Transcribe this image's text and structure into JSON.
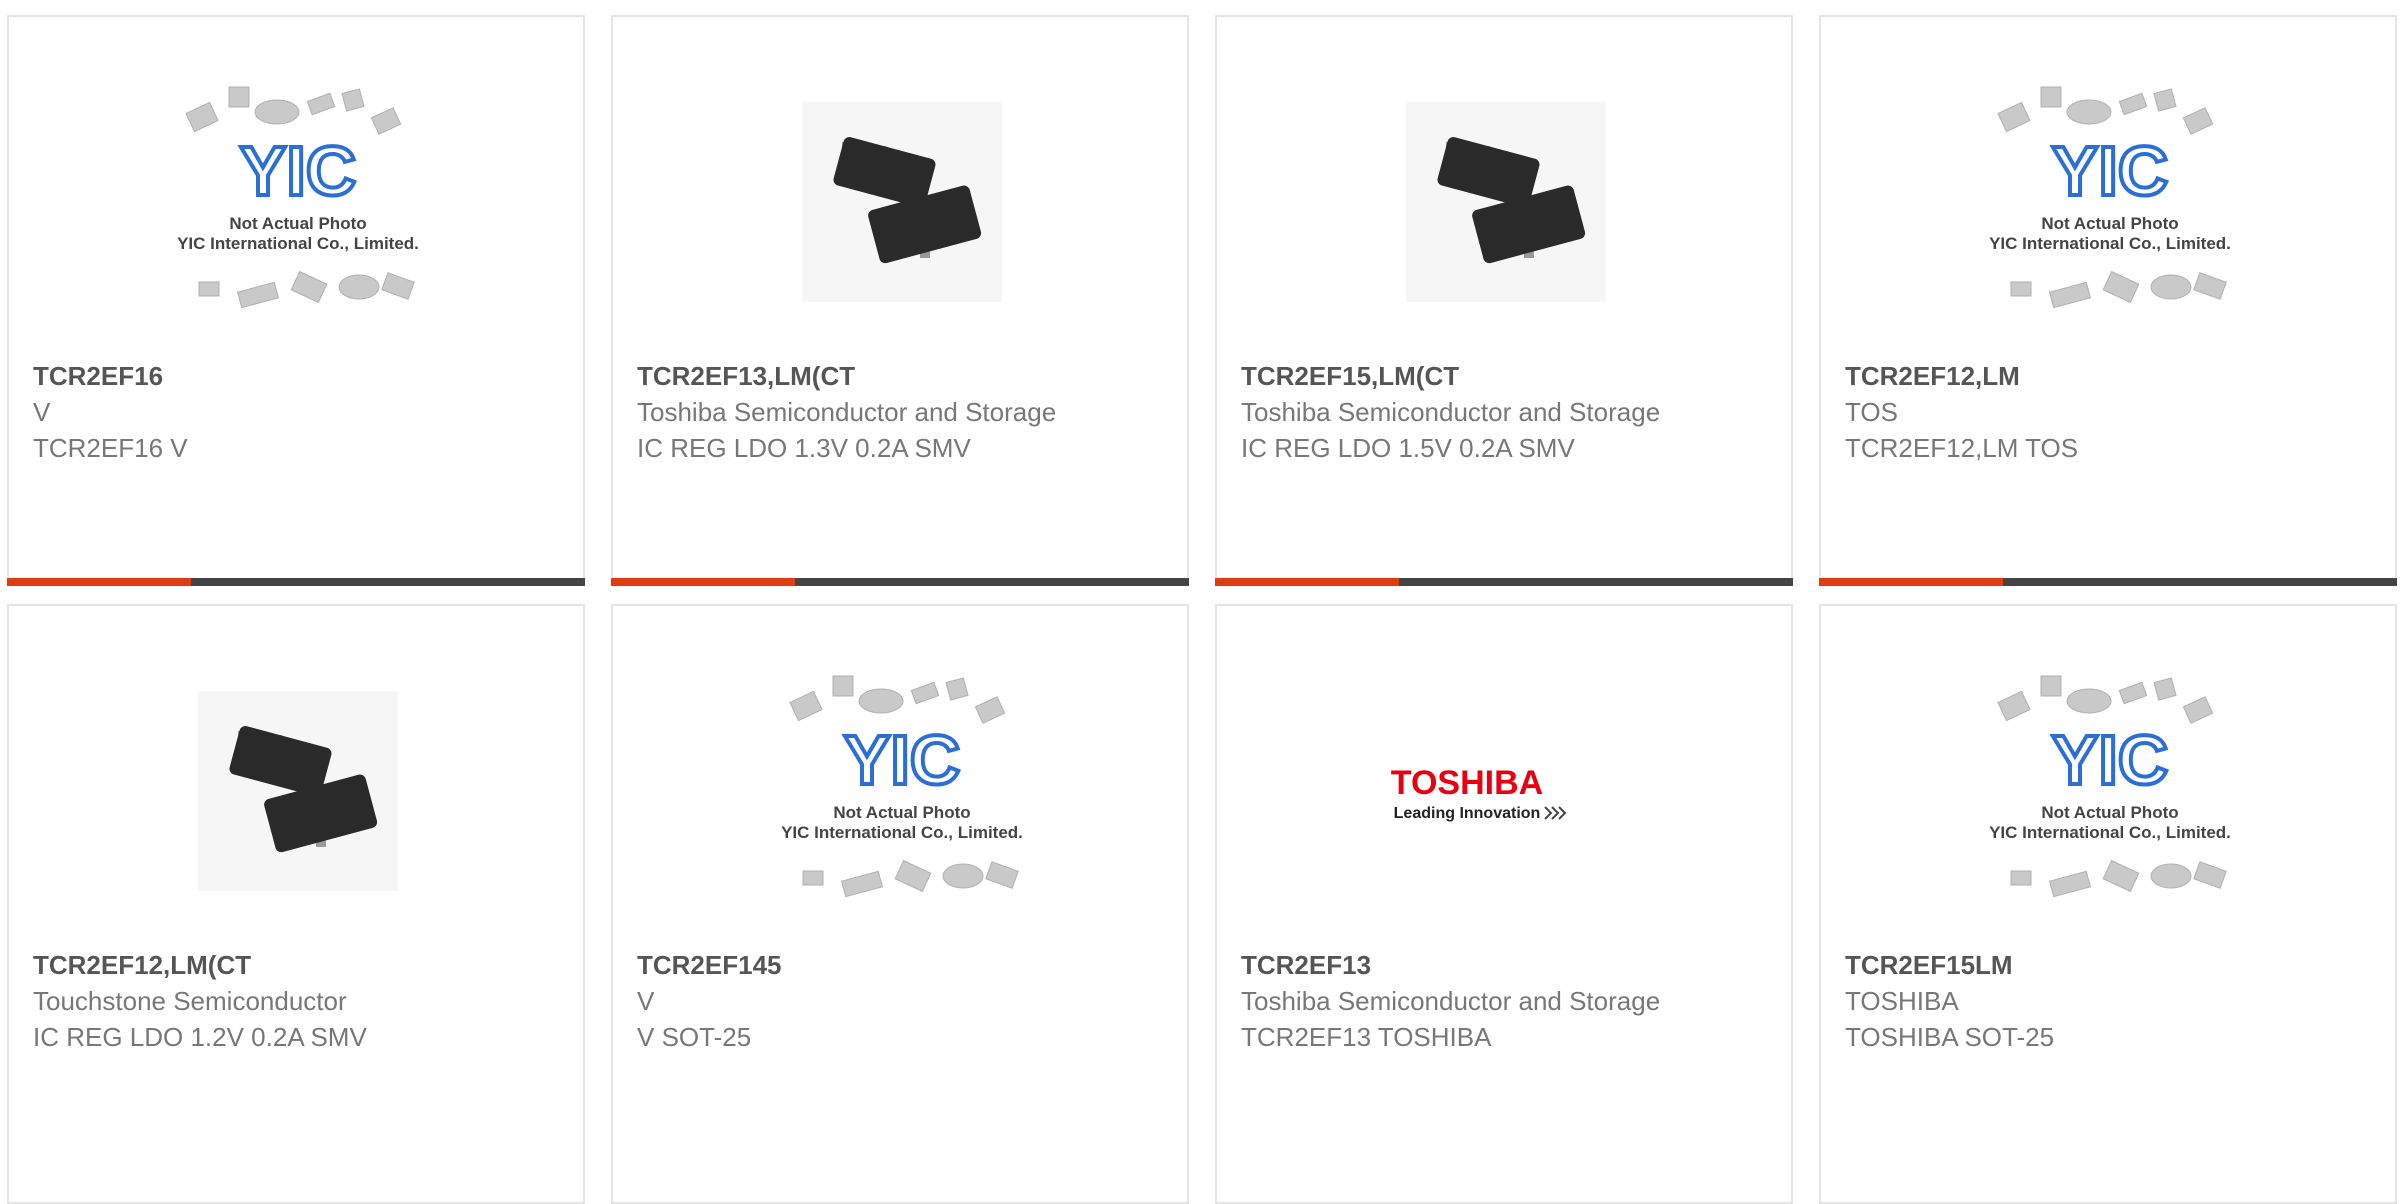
{
  "image_labels": {
    "not_actual_line1": "Not Actual Photo",
    "not_actual_line2": "YIC International Co., Limited.",
    "yic_logo": "YIC",
    "toshiba_logo": "TOSHIBA",
    "toshiba_tagline": "Leading Innovation"
  },
  "colors": {
    "accent": "#e03c12",
    "bar": "#444444",
    "logo_blue": "#2b6fd6",
    "toshiba_red": "#e60012"
  },
  "products": [
    {
      "name": "TCR2EF16",
      "lines": [
        "V",
        "TCR2EF16 V"
      ],
      "image": "placeholder"
    },
    {
      "name": "TCR2EF13,LM(CT",
      "lines": [
        "Toshiba Semiconductor and Storage",
        "IC REG LDO 1.3V 0.2A SMV"
      ],
      "image": "chip"
    },
    {
      "name": "TCR2EF15,LM(CT",
      "lines": [
        "Toshiba Semiconductor and Storage",
        "IC REG LDO 1.5V 0.2A SMV"
      ],
      "image": "chip"
    },
    {
      "name": "TCR2EF12,LM",
      "lines": [
        "TOS",
        "TCR2EF12,LM TOS"
      ],
      "image": "placeholder"
    },
    {
      "name": "TCR2EF12,LM(CT",
      "lines": [
        "Touchstone Semiconductor",
        "IC REG LDO 1.2V 0.2A SMV"
      ],
      "image": "chip"
    },
    {
      "name": "TCR2EF145",
      "lines": [
        "V",
        "V SOT-25"
      ],
      "image": "placeholder"
    },
    {
      "name": "TCR2EF13",
      "lines": [
        "Toshiba Semiconductor and Storage",
        "TCR2EF13 TOSHIBA"
      ],
      "image": "toshiba-logo"
    },
    {
      "name": "TCR2EF15LM",
      "lines": [
        "TOSHIBA",
        "TOSHIBA SOT-25"
      ],
      "image": "placeholder"
    }
  ]
}
